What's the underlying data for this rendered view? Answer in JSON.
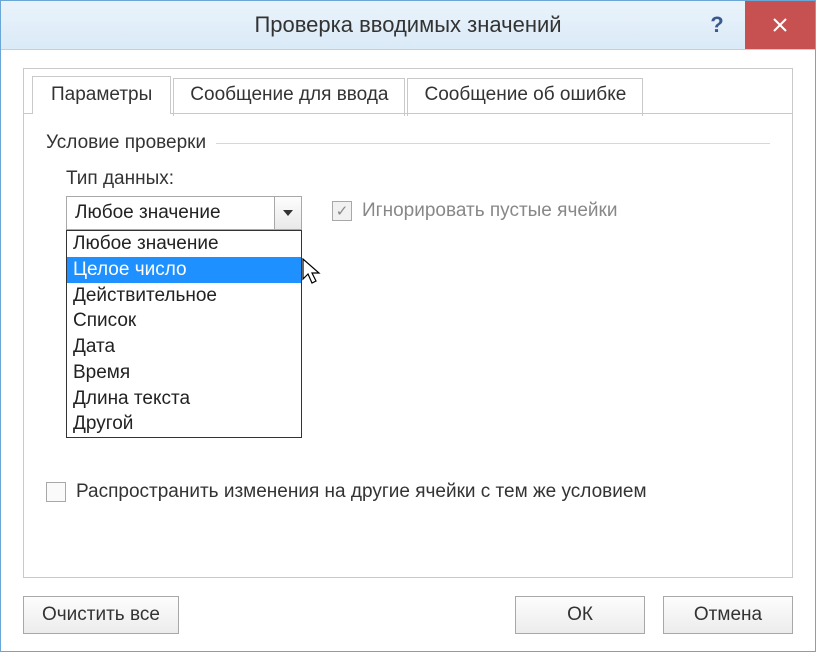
{
  "title": "Проверка вводимых значений",
  "tabs": {
    "parameters": "Параметры",
    "input_message": "Сообщение для ввода",
    "error_message": "Сообщение об ошибке"
  },
  "group_label": "Условие проверки",
  "type_label": "Тип данных:",
  "combo_selected": "Любое значение",
  "dropdown_items": [
    "Любое значение",
    "Целое число",
    "Действительное",
    "Список",
    "Дата",
    "Время",
    "Длина текста",
    "Другой"
  ],
  "highlight_index": 1,
  "ignore_blank_label": "Игнорировать пустые ячейки",
  "ignore_blank_checked": true,
  "propagate_label": "Распространить изменения на другие ячейки с тем же условием",
  "propagate_checked": false,
  "buttons": {
    "clear_all": "Очистить все",
    "ok": "ОК",
    "cancel": "Отмена"
  }
}
